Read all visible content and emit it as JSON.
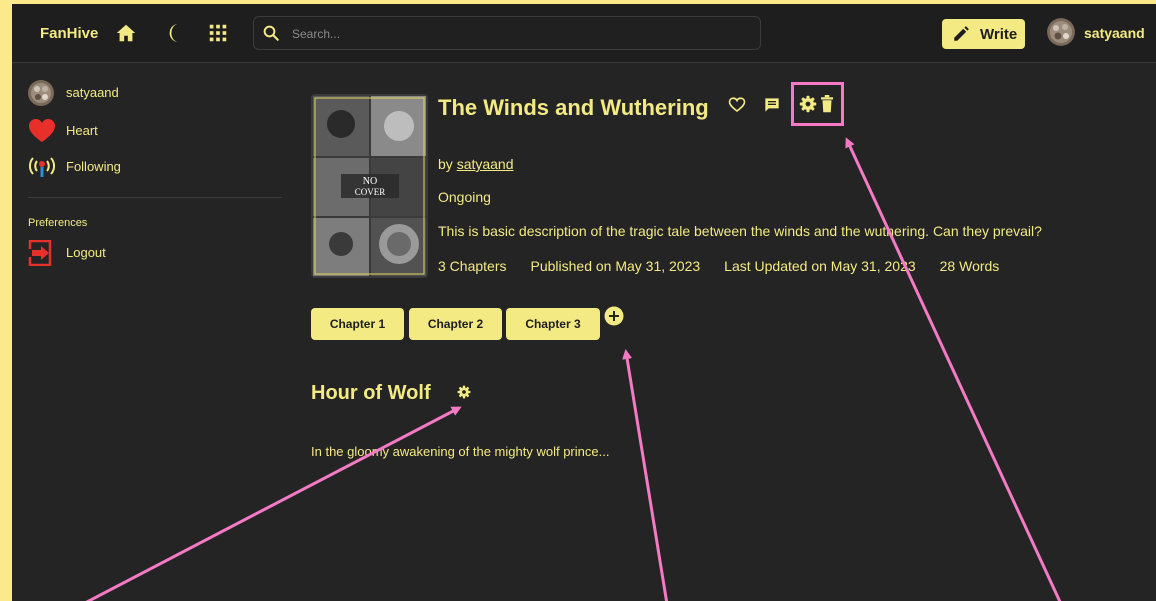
{
  "nav": {
    "brand": "FanHive",
    "search_placeholder": "Search...",
    "write_label": "Write",
    "username": "satyaand",
    "icons": [
      "home-icon",
      "moon-icon",
      "grid-icon",
      "search-icon",
      "pencil-icon"
    ]
  },
  "sidebar": {
    "items": [
      {
        "label": "satyaand",
        "icon": "avatar"
      },
      {
        "label": "Heart",
        "icon": "heart-icon"
      },
      {
        "label": "Following",
        "icon": "broadcast-icon"
      }
    ],
    "section_label": "Preferences",
    "logout_label": "Logout"
  },
  "story": {
    "title": "The Winds and Wuthering",
    "by_prefix": "by ",
    "author": "satyaand",
    "status": "Ongoing",
    "description": "This is basic description of the tragic tale between the winds and the wuthering. Can they prevail?",
    "chapters_count": "3 Chapters",
    "published": "Published on May 31, 2023",
    "updated": "Last Updated on May 31, 2023",
    "words": "28 Words",
    "cover_text_1": "NO",
    "cover_text_2": "COVER"
  },
  "chapters": {
    "buttons": [
      "Chapter 1",
      "Chapter 2",
      "Chapter 3"
    ]
  },
  "current_chapter": {
    "title": "Hour of Wolf",
    "text": "In the gloomy awakening of the mighty wolf prince..."
  },
  "colors": {
    "accent": "#f3ea84",
    "background": "#242424",
    "annotation": "#f47ac6",
    "heart": "#e8302a",
    "logout": "#e8302a"
  }
}
